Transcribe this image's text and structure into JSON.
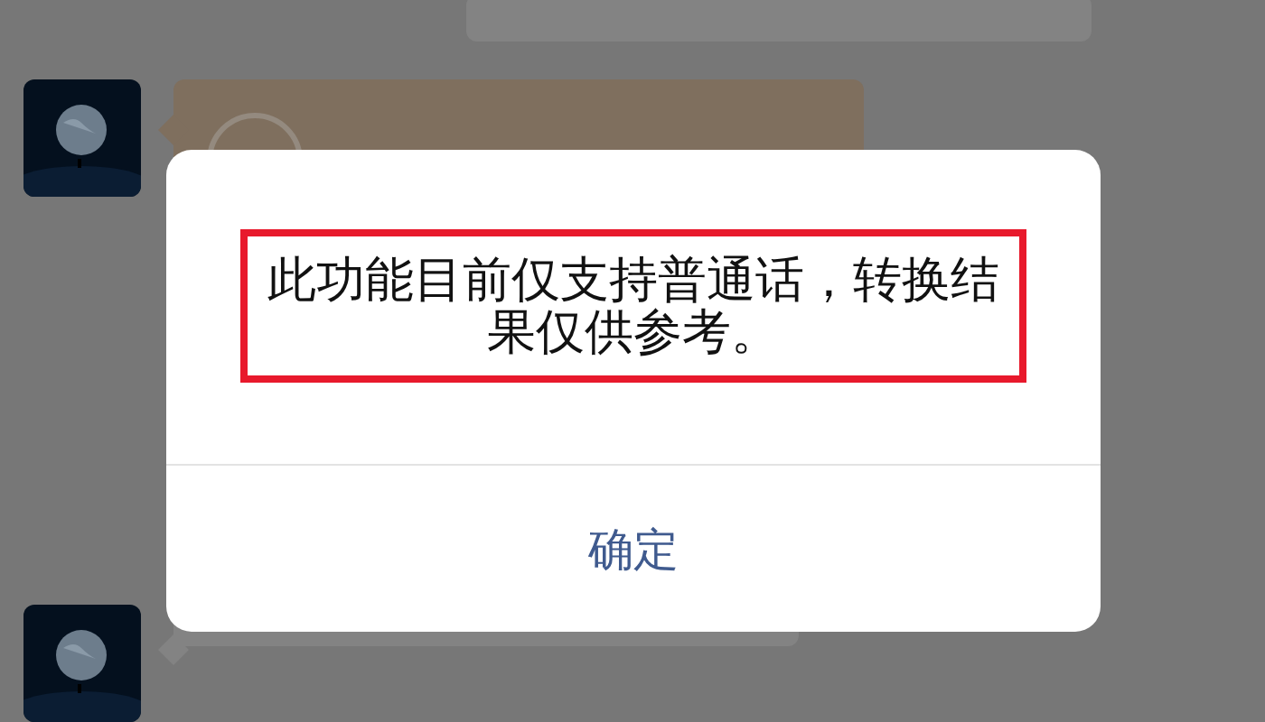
{
  "chat": {
    "messages": [
      {
        "outgoing": true,
        "kind": "text"
      },
      {
        "outgoing": false,
        "kind": "transfer"
      },
      {
        "outgoing": false,
        "kind": "text"
      }
    ]
  },
  "dialog": {
    "message": "此功能目前仅支持普通话，转换结果仅供参考。",
    "highlighted": true,
    "button": "确定"
  }
}
